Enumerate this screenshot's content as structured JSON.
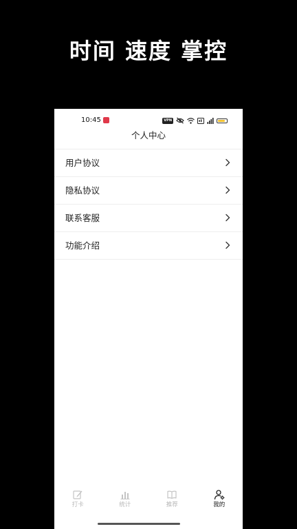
{
  "promo": {
    "title": "时间 速度 掌控"
  },
  "status_bar": {
    "time": "10:45",
    "vpn_label": "VPN",
    "battery_color": "#f1c232"
  },
  "header": {
    "title": "个人中心"
  },
  "menu": {
    "items": [
      {
        "label": "用户协议",
        "icon": "chevron-right-icon"
      },
      {
        "label": "隐私协议",
        "icon": "chevron-right-icon"
      },
      {
        "label": "联系客服",
        "icon": "chevron-right-icon"
      },
      {
        "label": "功能介绍",
        "icon": "chevron-right-icon"
      }
    ]
  },
  "tabs": {
    "items": [
      {
        "label": "打卡",
        "icon": "checkin-edit-icon",
        "active": false
      },
      {
        "label": "统计",
        "icon": "bar-chart-icon",
        "active": false
      },
      {
        "label": "推荐",
        "icon": "book-icon",
        "active": false
      },
      {
        "label": "我的",
        "icon": "user-gear-icon",
        "active": true
      }
    ]
  },
  "colors": {
    "background": "#000000",
    "panel": "#ffffff",
    "text": "#222222",
    "inactive_tab": "#b8b8b8",
    "divider": "#eeeeee"
  }
}
